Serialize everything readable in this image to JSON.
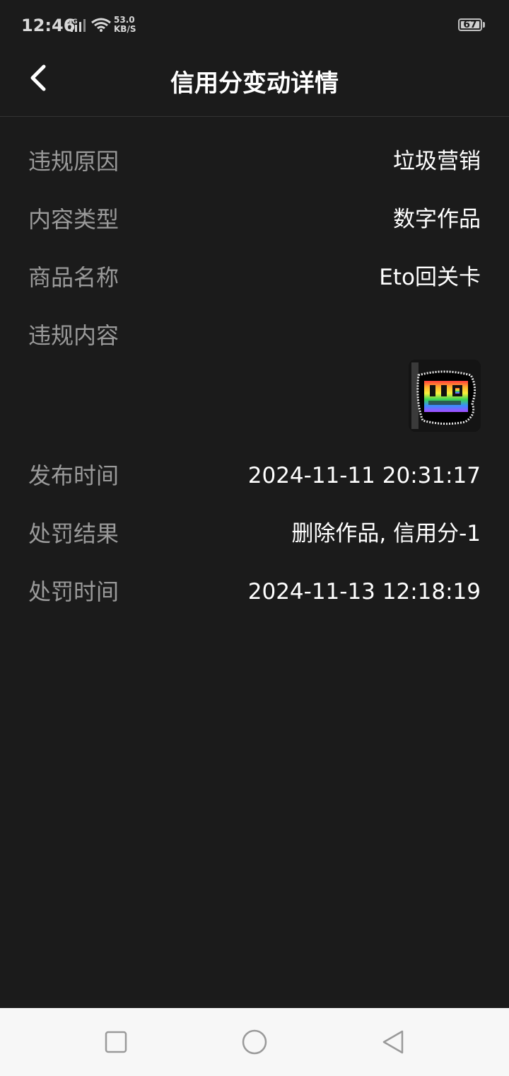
{
  "status_bar": {
    "time": "12:46",
    "network_type": "4G",
    "net_speed_value": "53.0",
    "net_speed_unit": "KB/S",
    "battery": "67"
  },
  "header": {
    "title": "信用分变动详情"
  },
  "details": {
    "violation_reason": {
      "label": "违规原因",
      "value": "垃圾营销"
    },
    "content_type": {
      "label": "内容类型",
      "value": "数字作品"
    },
    "product_name": {
      "label": "商品名称",
      "value": "Eto回关卡"
    },
    "violation_content": {
      "label": "违规内容"
    },
    "publish_time": {
      "label": "发布时间",
      "value": "2024-11-11 20:31:17"
    },
    "penalty_result": {
      "label": "处罚结果",
      "value": "删除作品, 信用分-1"
    },
    "penalty_time": {
      "label": "处罚时间",
      "value": "2024-11-13 12:18:19"
    }
  },
  "nav_bar": {
    "icons": [
      "recent-apps-icon",
      "home-icon",
      "back-icon"
    ]
  }
}
